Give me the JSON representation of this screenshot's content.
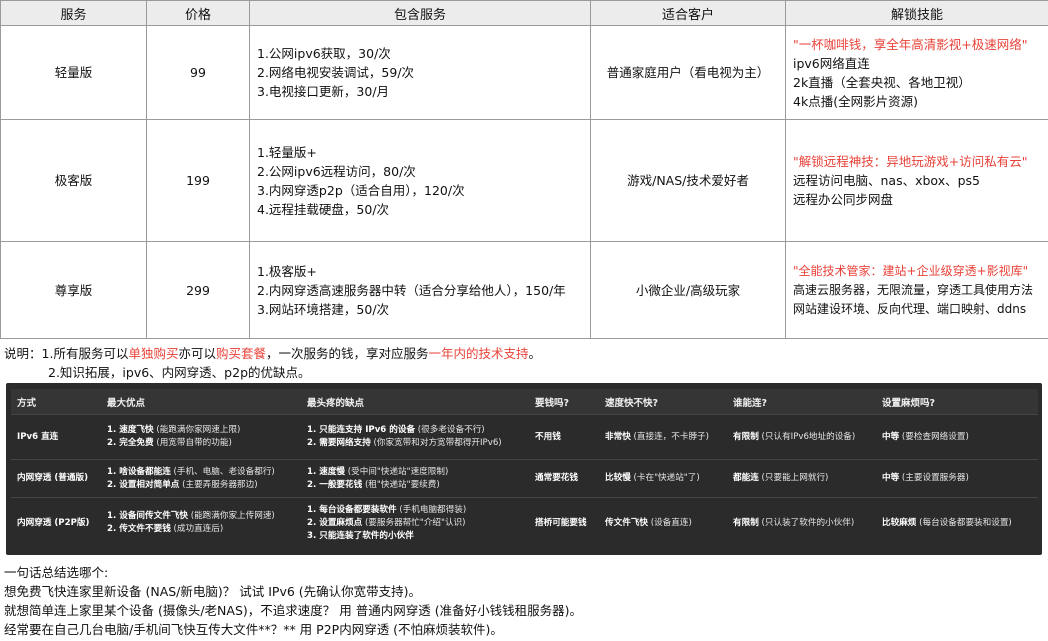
{
  "pricing_table": {
    "headers": [
      "服务",
      "价格",
      "包含服务",
      "适合客户",
      "解锁技能"
    ],
    "rows": [
      {
        "name": "轻量版",
        "price": "99",
        "services": [
          "1.公网ipv6获取，30/次",
          "2.网络电视安装调试，59/次",
          "3.电视接口更新，30/月"
        ],
        "customer": "普通家庭用户（看电视为主）",
        "skill_slogan": "\"一杯咖啡钱，享全年高清影视+极速网络\"",
        "skills": [
          "ipv6网络直连",
          "2k直播（全套央视、各地卫视）",
          "4k点播(全网影片资源)"
        ]
      },
      {
        "name": "极客版",
        "price": "199",
        "services": [
          "1.轻量版+",
          "2.公网ipv6远程访问，80/次",
          "3.内网穿透p2p（适合自用），120/次",
          "4.远程挂载硬盘，50/次"
        ],
        "customer": "游戏/NAS/技术爱好者",
        "skill_slogan": "\"解锁远程神技：异地玩游戏+访问私有云\"",
        "skills": [
          "远程访问电脑、nas、xbox、ps5",
          "远程办公同步网盘"
        ]
      },
      {
        "name": "尊享版",
        "price": "299",
        "services": [
          "1.极客版+",
          "2.内网穿透高速服务器中转（适合分享给他人），150/年",
          "3.网站环境搭建，50/次"
        ],
        "customer": "小微企业/高级玩家",
        "skill_slogan": "\"全能技术管家：建站+企业级穿透+影视库\"",
        "skills": [
          "高速云服务器，无限流量，穿透工具使用方法",
          "网站建设环境、反向代理、端口映射、ddns"
        ]
      }
    ]
  },
  "note": {
    "label": "说明：",
    "line1_a": "1.所有服务可以",
    "line1_red1": "单独购买",
    "line1_b": "亦可以",
    "line1_red2": "购买套餐",
    "line1_c": "，一次服务的钱，享对应服务",
    "line1_red3": "一年内的技术支持",
    "line1_d": "。",
    "line2": "2.知识拓展，ipv6、内网穿透、p2p的优缺点。"
  },
  "comparison": {
    "headers": [
      "方式",
      "最大优点",
      "最头疼的缺点",
      "要钱吗?",
      "速度快不快?",
      "谁能连?",
      "设置麻烦吗?"
    ],
    "rows": [
      {
        "method": "IPv6 直连",
        "pros": [
          {
            "b": "1. 速度飞快",
            "t": " (能跑满你家网速上限)"
          },
          {
            "b": "2. 完全免费",
            "t": " (用宽带自带的功能)"
          }
        ],
        "cons": [
          {
            "b": "1. 只能连支持 IPv6 的设备",
            "t": " (很多老设备不行)"
          },
          {
            "b": "2. 需要网络支持",
            "t": " (你家宽带和对方宽带都得开IPv6)"
          }
        ],
        "cost": {
          "b": "不用钱",
          "t": ""
        },
        "speed": {
          "b": "非常快",
          "t": " (直接连，不卡脖子)"
        },
        "who": {
          "b": "有限制",
          "t": " (只认有IPv6地址的设备)"
        },
        "setup": {
          "b": "中等",
          "t": " (要检查网络设置)"
        }
      },
      {
        "method": "内网穿透 (普通版)",
        "pros": [
          {
            "b": "1. 啥设备都能连",
            "t": " (手机、电脑、老设备都行)"
          },
          {
            "b": "2. 设置相对简单点",
            "t": " (主要弄服务器那边)"
          }
        ],
        "cons": [
          {
            "b": "1. 速度慢",
            "t": " (受中间\"快递站\"速度限制)"
          },
          {
            "b": "2. 一般要花钱",
            "t": " (租\"快递站\"要续费)"
          }
        ],
        "cost": {
          "b": "通常要花钱",
          "t": ""
        },
        "speed": {
          "b": "比较慢",
          "t": " (卡在\"快递站\"了)"
        },
        "who": {
          "b": "都能连",
          "t": " (只要能上网就行)"
        },
        "setup": {
          "b": "中等",
          "t": " (主要设置服务器)"
        }
      },
      {
        "method": "内网穿透 (P2P版)",
        "pros": [
          {
            "b": "1. 设备间传文件飞快",
            "t": " (能跑满你家上传网速)"
          },
          {
            "b": "2. 传文件不要钱",
            "t": " (成功直连后)"
          }
        ],
        "cons": [
          {
            "b": "1. 每台设备都要装软件",
            "t": " (手机电脑都得装)"
          },
          {
            "b": "2. 设置麻烦点",
            "t": " (要服务器帮忙\"介绍\"认识)"
          },
          {
            "b": "3. 只能连装了软件的小伙伴",
            "t": ""
          }
        ],
        "cost": {
          "b": "搭桥可能要钱",
          "t": ""
        },
        "speed": {
          "b": "传文件飞快",
          "t": " (设备直连)"
        },
        "who": {
          "b": "有限制",
          "t": " (只认装了软件的小伙伴)"
        },
        "setup": {
          "b": "比较麻烦",
          "t": " (每台设备都要装和设置)"
        }
      }
    ]
  },
  "summary": {
    "lines": [
      "一句话总结选哪个:",
      "想免费飞快连家里新设备 (NAS/新电脑)？ 试试 IPv6 (先确认你宽带支持)。",
      "就想简单连上家里某个设备 (摄像头/老NAS)，不追求速度？ 用 普通内网穿透 (准备好小钱钱租服务器)。",
      "经常要在自己几台电脑/手机间飞快互传大文件**？** 用 P2P内网穿透 (不怕麻烦装软件)。"
    ]
  }
}
